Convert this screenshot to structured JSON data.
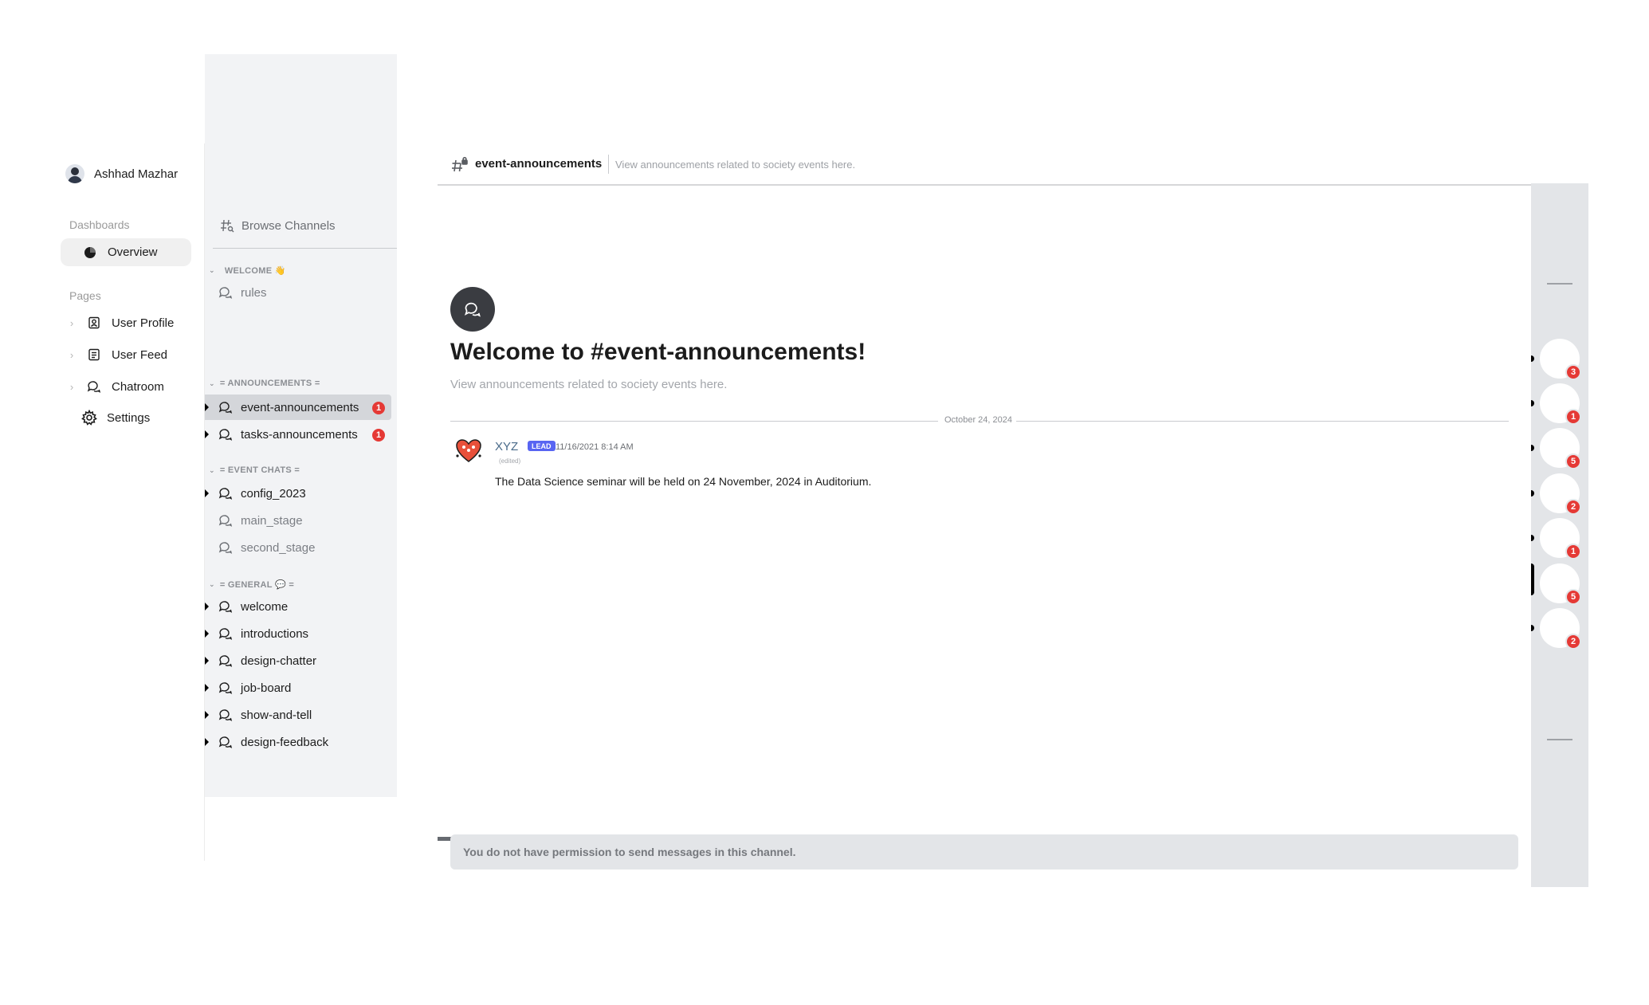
{
  "user": {
    "name": "Ashhad Mazhar"
  },
  "nav": {
    "dashboards_label": "Dashboards",
    "overview_label": "Overview",
    "pages_label": "Pages",
    "pages": [
      {
        "label": "User Profile",
        "icon": "user-profile-icon"
      },
      {
        "label": "User Feed",
        "icon": "feed-icon"
      },
      {
        "label": "Chatroom",
        "icon": "chat-icon"
      }
    ],
    "settings_label": "Settings"
  },
  "sidebar": {
    "browse_label": "Browse Channels",
    "categories": [
      {
        "label": "WELCOME 👋",
        "channels": [
          {
            "name": "rules",
            "unread": false,
            "muted": true
          }
        ]
      },
      {
        "label": "= ANNOUNCEMENTS =",
        "channels": [
          {
            "name": "event-announcements",
            "unread": true,
            "selected": true,
            "badge": "1"
          },
          {
            "name": "tasks-announcements",
            "unread": true,
            "badge": "1"
          }
        ]
      },
      {
        "label": "= EVENT CHATS =",
        "channels": [
          {
            "name": "config_2023",
            "unread": true
          },
          {
            "name": "main_stage",
            "unread": false,
            "muted": true
          },
          {
            "name": "second_stage",
            "unread": false,
            "muted": true
          }
        ]
      },
      {
        "label": "= GENERAL 💬 =",
        "channels": [
          {
            "name": "welcome",
            "unread": true
          },
          {
            "name": "introductions",
            "unread": true
          },
          {
            "name": "design-chatter",
            "unread": true
          },
          {
            "name": "job-board",
            "unread": true
          },
          {
            "name": "show-and-tell",
            "unread": true
          },
          {
            "name": "design-feedback",
            "unread": true
          }
        ]
      }
    ]
  },
  "channel": {
    "name": "event-announcements",
    "topic": "View announcements related to society events here.",
    "welcome_title": "Welcome to #event-announcements!",
    "welcome_subtitle": "View announcements related to society events here."
  },
  "messages": {
    "date_divider": "October 24, 2024",
    "items": [
      {
        "author": "XYZ",
        "role": "LEAD",
        "timestamp": "11/16/2021 8:14 AM",
        "edited": "(edited)",
        "text": "The Data Science seminar will be held on 24 November, 2024 in Auditorium."
      }
    ]
  },
  "composer": {
    "notice": "You do not have permission to send messages in this channel."
  },
  "servers": [
    {
      "badge": "3"
    },
    {
      "badge": "1"
    },
    {
      "badge": "5"
    },
    {
      "badge": "2"
    },
    {
      "badge": "1"
    },
    {
      "badge": "5",
      "selected": true
    },
    {
      "badge": "2"
    }
  ],
  "colors": {
    "badge": "#e53935",
    "role_tag": "#5865f2",
    "sidebar_bg": "#f2f3f5",
    "rail_bg": "#e3e5e8"
  }
}
